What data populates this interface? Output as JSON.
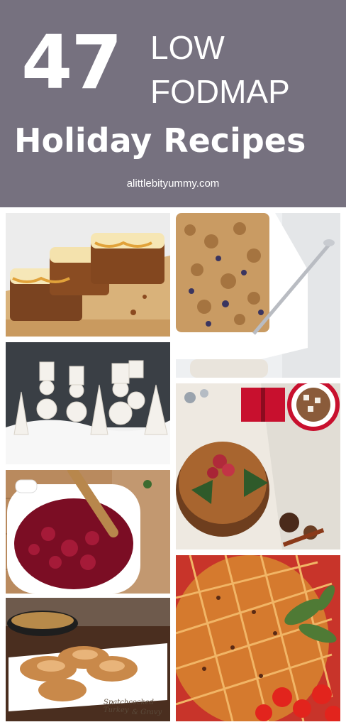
{
  "banner": {
    "number": "47",
    "line1": "LOW",
    "line2": "FODMAP",
    "line3": "Holiday Recipes",
    "site": "alittlebityummy.com",
    "background_color": "#76717f"
  },
  "photos": {
    "turkey_caption_line1": "Spatchcocked Turkey",
    "turkey_caption_line2": "& Gravy"
  }
}
